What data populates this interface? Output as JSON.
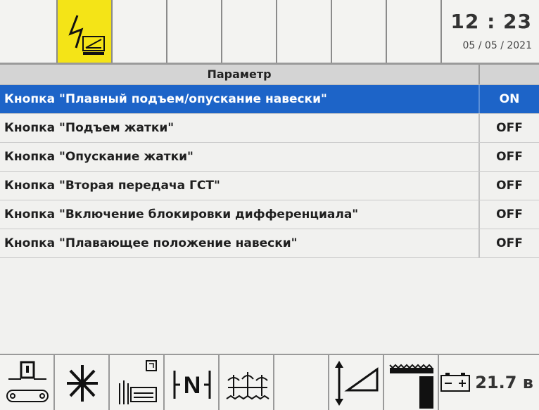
{
  "status": {
    "time": "12 : 23",
    "date": "05 / 05 / 2021",
    "voltage": "21.7 в",
    "active_tab_icon": "electrical-diagnostics-icon",
    "active_tab_color": "#f4e417"
  },
  "table": {
    "header": "Параметр",
    "rows": [
      {
        "label": "Кнопка \"Плавный подъем/опускание навески\"",
        "value": "ON"
      },
      {
        "label": "Кнопка \"Подъем жатки\"",
        "value": "OFF"
      },
      {
        "label": "Кнопка \"Опускание жатки\"",
        "value": "OFF"
      },
      {
        "label": "Кнопка \"Вторая передача ГСТ\"",
        "value": "OFF"
      },
      {
        "label": "Кнопка \"Включение блокировки дифференциала\"",
        "value": "OFF"
      },
      {
        "label": "Кнопка \"Плавающее положение навески\"",
        "value": "OFF"
      }
    ],
    "selected_row": 0,
    "selected_color": "#1d64c8"
  },
  "bottom_icons": [
    "conveyor-icon",
    "fan-icon",
    "unloading-icon",
    "neutral-gear-icon",
    "crop-field-icon",
    "empty",
    "header-height-icon",
    "reel-position-icon",
    "battery-icon"
  ],
  "top_labels": {
    "date_prefix": "05 / 05 / 2021",
    "neutral_label": "N"
  }
}
